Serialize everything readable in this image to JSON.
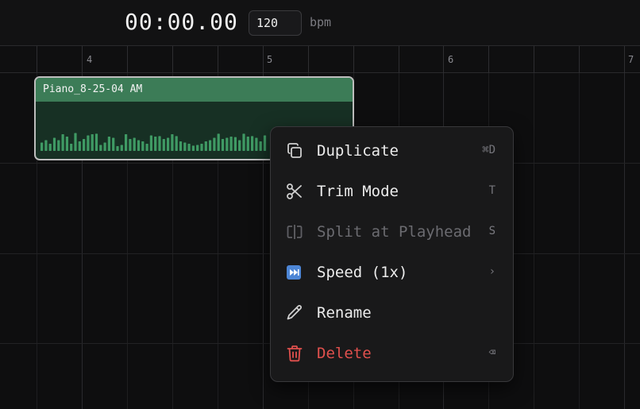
{
  "transport": {
    "time": "00:00.00",
    "bpm_value": "120",
    "bpm_label": "bpm"
  },
  "ruler": {
    "markers": [
      "4",
      "5",
      "6",
      "7"
    ]
  },
  "clip": {
    "name": "Piano_8-25-04 AM",
    "color": "#3c7c57",
    "waveform_color": "#3f9a64",
    "waveform_levels": [
      0.35,
      0.45,
      0.3,
      0.55,
      0.45,
      0.7,
      0.6,
      0.3,
      0.75,
      0.4,
      0.5,
      0.65,
      0.7,
      0.72,
      0.25,
      0.35,
      0.6,
      0.55,
      0.2,
      0.25,
      0.7,
      0.5,
      0.55,
      0.45,
      0.4,
      0.3,
      0.65,
      0.6,
      0.62,
      0.5,
      0.55,
      0.7,
      0.62,
      0.4,
      0.35,
      0.3,
      0.22,
      0.25,
      0.3,
      0.4,
      0.45,
      0.55,
      0.72,
      0.5,
      0.55,
      0.6,
      0.58,
      0.45,
      0.72,
      0.6,
      0.62,
      0.55,
      0.4,
      0.65
    ]
  },
  "context_menu": {
    "items": [
      {
        "id": "duplicate",
        "label": "Duplicate",
        "shortcut": "⌘D",
        "icon": "duplicate-icon",
        "state": "normal"
      },
      {
        "id": "trim-mode",
        "label": "Trim Mode",
        "shortcut": "T",
        "icon": "scissors-icon",
        "state": "normal"
      },
      {
        "id": "split",
        "label": "Split at Playhead",
        "shortcut": "S",
        "icon": "split-icon",
        "state": "disabled"
      },
      {
        "id": "speed",
        "label": "Speed (1x)",
        "shortcut": "›",
        "icon": "fast-forward-icon",
        "state": "submenu"
      },
      {
        "id": "rename",
        "label": "Rename",
        "shortcut": "",
        "icon": "pencil-icon",
        "state": "normal"
      },
      {
        "id": "delete",
        "label": "Delete",
        "shortcut": "⌫",
        "icon": "trash-icon",
        "state": "danger"
      }
    ]
  },
  "colors": {
    "background": "#0e0e0f",
    "menu_bg": "#19191a",
    "danger": "#e0504d",
    "speed_icon": "#4d86d6"
  }
}
